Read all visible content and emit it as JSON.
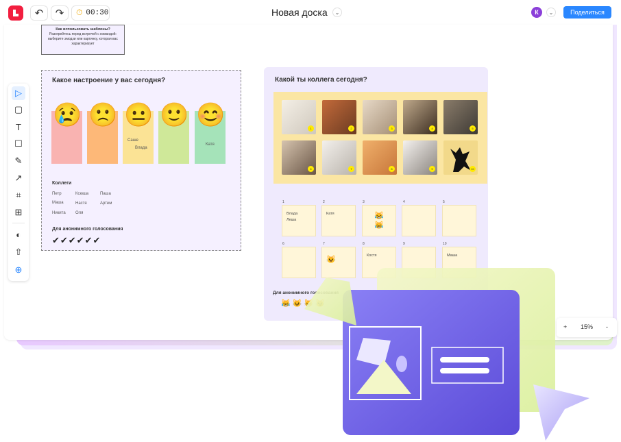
{
  "header": {
    "title": "Новая доска",
    "timer": "00:30",
    "avatar_initial": "К",
    "share_label": "Поделиться",
    "undo_icon": "undo-icon",
    "redo_icon": "redo-icon",
    "timer_icon": "stopwatch-icon"
  },
  "howto": {
    "title": "Как использовать шаблоны?",
    "body": "Разогрейтесь перед встречей с командой: выберите эмодзи или картинку, которая вас характеризует"
  },
  "toolbar": {
    "tools": [
      "cursor-icon",
      "sticky-note-icon",
      "text-icon",
      "rectangle-icon",
      "pen-icon",
      "connector-icon",
      "frame-icon",
      "table-icon",
      "palette-icon",
      "upload-icon",
      "add-icon"
    ]
  },
  "mood": {
    "title": "Какое настроение у вас сегодня?",
    "colors": [
      "#f9b3b1",
      "#fdb878",
      "#fbe395",
      "#cfe899",
      "#a5e3b9"
    ],
    "bar_names": [
      "",
      "",
      "Саше\nВлада",
      "",
      "Катя"
    ],
    "colleagues_title": "Коллеги",
    "colleagues": [
      "Петр",
      "Ксюша",
      "Паша",
      "Маша",
      "Настя",
      "Артем",
      "Никита",
      "Оля"
    ],
    "anon_title": "Для анонимного голосования",
    "checks": "✔✔✔✔✔✔"
  },
  "colleague": {
    "title": "Какой ты коллега сегодня?",
    "cat_numbers": [
      "1",
      "2",
      "3",
      "4",
      "5",
      "6",
      "7",
      "8",
      "9",
      "10"
    ],
    "slots": [
      {
        "num": "1",
        "text": "Влада\nЛеша"
      },
      {
        "num": "2",
        "text": "Катя"
      },
      {
        "num": "3",
        "text": "😹\n😹"
      },
      {
        "num": "4",
        "text": ""
      },
      {
        "num": "5",
        "text": ""
      },
      {
        "num": "6",
        "text": ""
      },
      {
        "num": "7",
        "text": "😺"
      },
      {
        "num": "8",
        "text": "Костя"
      },
      {
        "num": "9",
        "text": ""
      },
      {
        "num": "10",
        "text": "Маша"
      }
    ],
    "anon_title": "Для анонимного голосования",
    "anon_emojis": "😹 😺 😸 😼"
  },
  "zoom": {
    "plus": "+",
    "level": "15%",
    "minus": "-"
  }
}
